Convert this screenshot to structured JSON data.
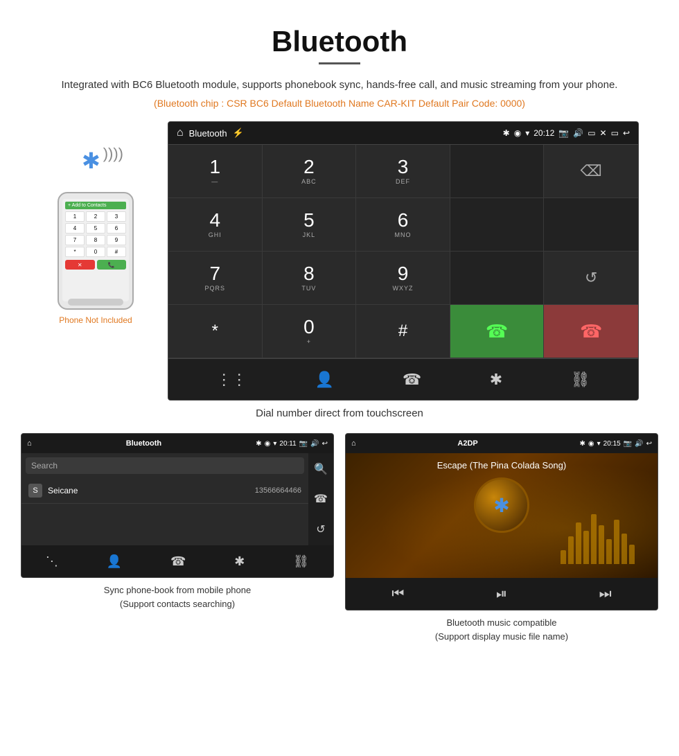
{
  "page": {
    "title": "Bluetooth",
    "subtitle": "Integrated with BC6 Bluetooth module, supports phonebook sync, hands-free call, and music streaming from your phone.",
    "bluetooth_info": "(Bluetooth chip : CSR BC6    Default Bluetooth Name CAR-KIT    Default Pair Code: 0000)"
  },
  "dialer_screen": {
    "app_name": "Bluetooth",
    "time": "20:12",
    "keys": [
      {
        "num": "1",
        "sub": ""
      },
      {
        "num": "2",
        "sub": "ABC"
      },
      {
        "num": "3",
        "sub": "DEF"
      },
      {
        "num": "",
        "sub": ""
      },
      {
        "num": "⌫",
        "sub": ""
      },
      {
        "num": "4",
        "sub": "GHI"
      },
      {
        "num": "5",
        "sub": "JKL"
      },
      {
        "num": "6",
        "sub": "MNO"
      },
      {
        "num": "",
        "sub": ""
      },
      {
        "num": "",
        "sub": ""
      },
      {
        "num": "7",
        "sub": "PQRS"
      },
      {
        "num": "8",
        "sub": "TUV"
      },
      {
        "num": "9",
        "sub": "WXYZ"
      },
      {
        "num": "",
        "sub": ""
      },
      {
        "num": "↺",
        "sub": ""
      },
      {
        "num": "*",
        "sub": ""
      },
      {
        "num": "0",
        "sub": "+"
      },
      {
        "num": "#",
        "sub": ""
      },
      {
        "num": "📞",
        "sub": "call"
      },
      {
        "num": "📵",
        "sub": "end"
      }
    ]
  },
  "main_caption": "Dial number direct from touchscreen",
  "phonebook": {
    "app_name": "Bluetooth",
    "time": "20:11",
    "search_placeholder": "Search",
    "contacts": [
      {
        "letter": "S",
        "name": "Seicane",
        "phone": "13566664466"
      }
    ],
    "caption_line1": "Sync phone-book from mobile phone",
    "caption_line2": "(Support contacts searching)"
  },
  "music": {
    "app_name": "A2DP",
    "time": "20:15",
    "song_title": "Escape (The Pina Colada Song)",
    "caption_line1": "Bluetooth music compatible",
    "caption_line2": "(Support display music file name)"
  },
  "icons": {
    "home": "⌂",
    "usb": "⚡",
    "bluetooth": "✱",
    "location": "◉",
    "wifi": "▾",
    "camera": "📷",
    "volume": "🔊",
    "screen": "▭",
    "back": "↩",
    "grid": "⊞",
    "person": "👤",
    "phone": "📞",
    "bt": "✱",
    "link": "🔗",
    "search": "🔍",
    "redial": "↺",
    "prev": "⏮",
    "play": "⏯",
    "next": "⏭"
  }
}
